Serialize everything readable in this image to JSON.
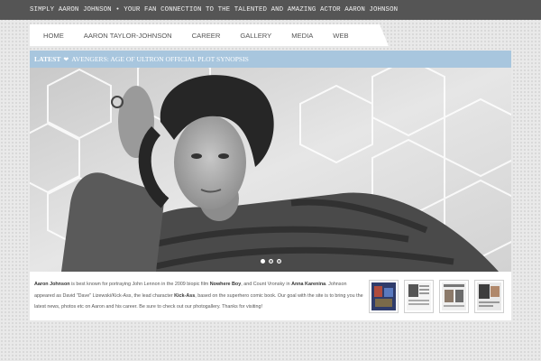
{
  "header": {
    "tagline": "SIMPLY AARON JOHNSON • YOUR FAN CONNECTION TO THE TALENTED AND AMAZING ACTOR AARON JOHNSON"
  },
  "nav": {
    "items": [
      "HOME",
      "AARON TAYLOR-JOHNSON",
      "CAREER",
      "GALLERY",
      "MEDIA",
      "WEB"
    ]
  },
  "latest": {
    "label": "LATEST",
    "icon": "heart-icon",
    "headline": "AVENGERS: AGE OF ULTRON OFFICIAL PLOT SYNOPSIS"
  },
  "slider": {
    "slide_count": 3,
    "active_slide": 1,
    "photo": "black-and-white portrait photo"
  },
  "intro": {
    "name": "Aaron Johnson",
    "t1": " is best known for portraying John Lennon in the 2009 biopic film ",
    "film1": "Nowhere Boy",
    "t2": ", and Count Vronsky in ",
    "film2": "Anna Karenina",
    "t3": ". Johnson appeared as David \"Dave\" Lizewski/Kick-Ass, the lead character ",
    "film3": "Kick-Ass",
    "t4": ", based on the superhero comic book. Our goal with the site is to bring you the latest news, photos etc on Aaron and his career. Be sure to check out our photogallery. Thanks for visiting!"
  },
  "thumbnails": [
    {
      "kind": "poster"
    },
    {
      "kind": "magazine"
    },
    {
      "kind": "magazine"
    },
    {
      "kind": "magazine"
    }
  ]
}
